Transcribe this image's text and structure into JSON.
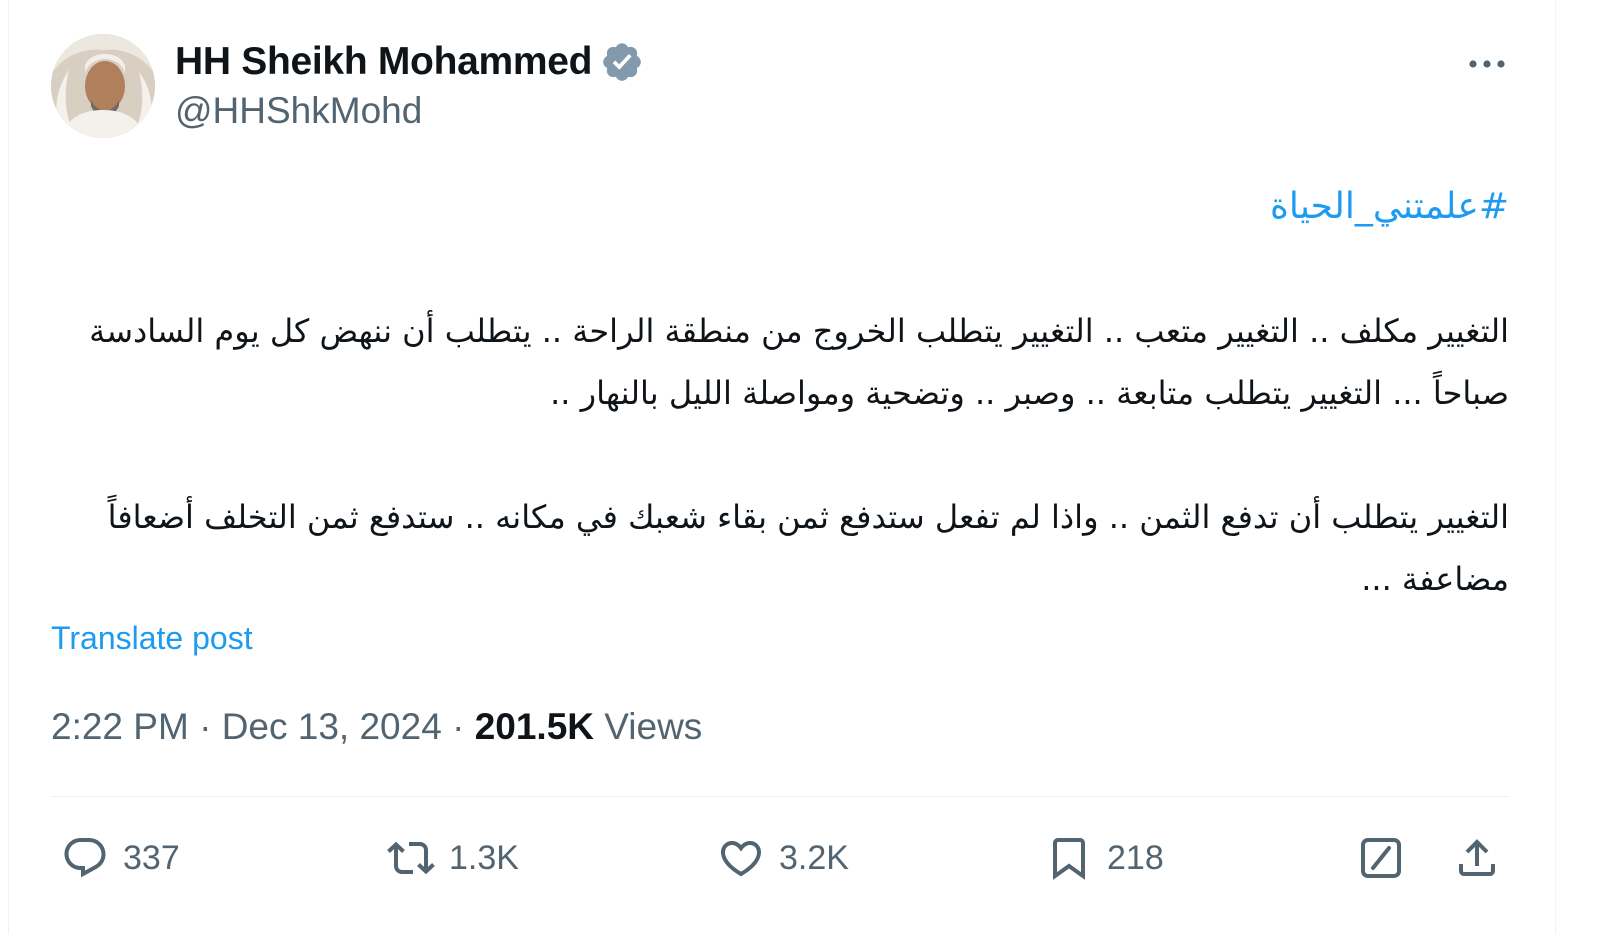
{
  "author": {
    "display_name": "HH Sheikh Mohammed",
    "handle": "@HHShkMohd",
    "verified_color": "#829aab"
  },
  "post": {
    "hashtag": "#علمتني_الحياة",
    "paragraphs": [
      "التغيير مكلف .. التغيير متعب .. التغيير يتطلب الخروج من منطقة الراحة .. يتطلب أن ننهض كل يوم السادسة صباحاً ... التغيير يتطلب متابعة .. وصبر .. وتضحية ومواصلة الليل بالنهار ..",
      "التغيير يتطلب أن تدفع الثمن .. واذا لم تفعل ستدفع ثمن بقاء شعبك في مكانه .. ستدفع ثمن التخلف أضعافاً مضاعفة ..."
    ],
    "translate_label": "Translate post",
    "time": "2:22 PM",
    "date": "Dec 13, 2024",
    "separator": "·",
    "views_count": "201.5K",
    "views_label": "Views"
  },
  "actions": {
    "replies": "337",
    "reposts": "1.3K",
    "likes": "3.2K",
    "bookmarks": "218"
  },
  "icons": {
    "more": "more-icon",
    "reply": "reply-icon",
    "repost": "repost-icon",
    "like": "heart-icon",
    "bookmark": "bookmark-icon",
    "grok": "grok-icon",
    "share": "share-icon"
  },
  "colors": {
    "link": "#1d9bf0",
    "secondary_text": "#536471",
    "primary_text": "#0f1419",
    "divider": "#eff3f4"
  }
}
